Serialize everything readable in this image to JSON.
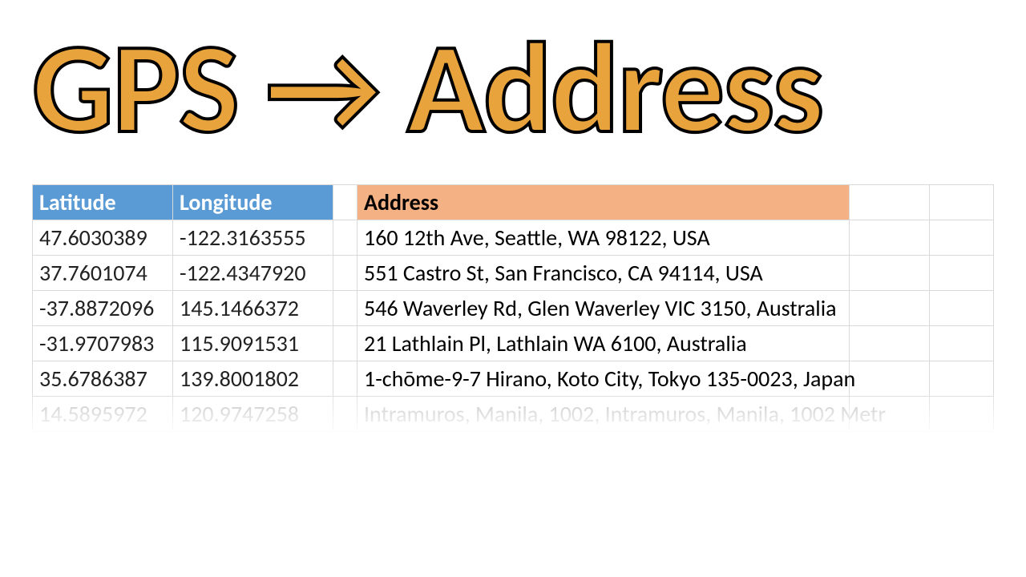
{
  "title": "GPS → Address",
  "table": {
    "headers": {
      "latitude": "Latitude",
      "longitude": "Longitude",
      "address": "Address"
    },
    "rows": [
      {
        "lat": "47.6030389",
        "lon": "-122.3163555",
        "addr": "160 12th Ave, Seattle, WA 98122, USA"
      },
      {
        "lat": "37.7601074",
        "lon": "-122.4347920",
        "addr": "551 Castro St, San Francisco, CA 94114, USA"
      },
      {
        "lat": "-37.8872096",
        "lon": "145.1466372",
        "addr": "546 Waverley Rd, Glen Waverley VIC 3150, Australia"
      },
      {
        "lat": "-31.9707983",
        "lon": "115.9091531",
        "addr": "21 Lathlain Pl, Lathlain WA 6100, Australia"
      },
      {
        "lat": "35.6786387",
        "lon": "139.8001802",
        "addr": "1-chōme-9-7 Hirano, Koto City, Tokyo 135-0023, Japan"
      },
      {
        "lat": "14.5895972",
        "lon": "120.9747258",
        "addr": "Intramuros, Manila, 1002, Intramuros, Manila, 1002 Metr"
      }
    ]
  }
}
